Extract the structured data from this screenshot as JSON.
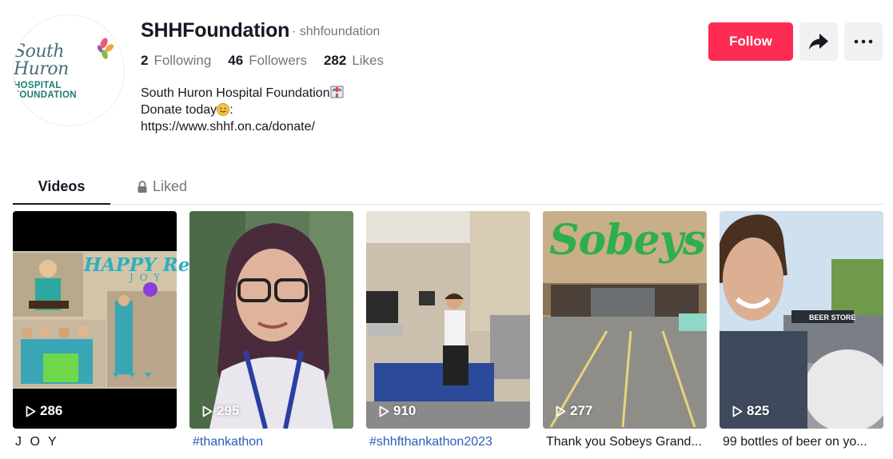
{
  "profile": {
    "username": "SHHFoundation",
    "nickname": "· shhfoundation",
    "avatar_logo": {
      "line1": "South Huron",
      "line2": "HOSPITAL FOUNDATION"
    },
    "stats": [
      {
        "num": "2",
        "label": "Following"
      },
      {
        "num": "46",
        "label": "Followers"
      },
      {
        "num": "282",
        "label": "Likes"
      }
    ],
    "bio": {
      "line1": "South Huron Hospital Foundation",
      "line2": "Donate today",
      "line2_suffix": ":",
      "line3": "https://www.shhf.on.ca/donate/"
    }
  },
  "actions": {
    "follow_label": "Follow",
    "share_icon": "share-icon",
    "more_icon": "more-icon"
  },
  "tabs": [
    {
      "label": "Videos",
      "active": true
    },
    {
      "label": "Liked",
      "active": false,
      "icon": "lock-icon"
    }
  ],
  "videos": [
    {
      "views": "286",
      "caption": "J O Y",
      "thumb_text": "HAPPY Retirement",
      "thumb_sub": "J O Y"
    },
    {
      "views": "295",
      "caption": "#thankathon"
    },
    {
      "views": "910",
      "caption": "#shhfthankathon2023"
    },
    {
      "views": "277",
      "caption": "Thank you Sobeys Grand...",
      "thumb_text": "Sobeys"
    },
    {
      "views": "825",
      "caption": "99 bottles of beer on yo...",
      "thumb_text": "BEER STORE"
    }
  ],
  "colors": {
    "accent": "#fe2c55",
    "text": "#161823",
    "muted": "#75767d",
    "hashtag": "#2b5db9"
  }
}
